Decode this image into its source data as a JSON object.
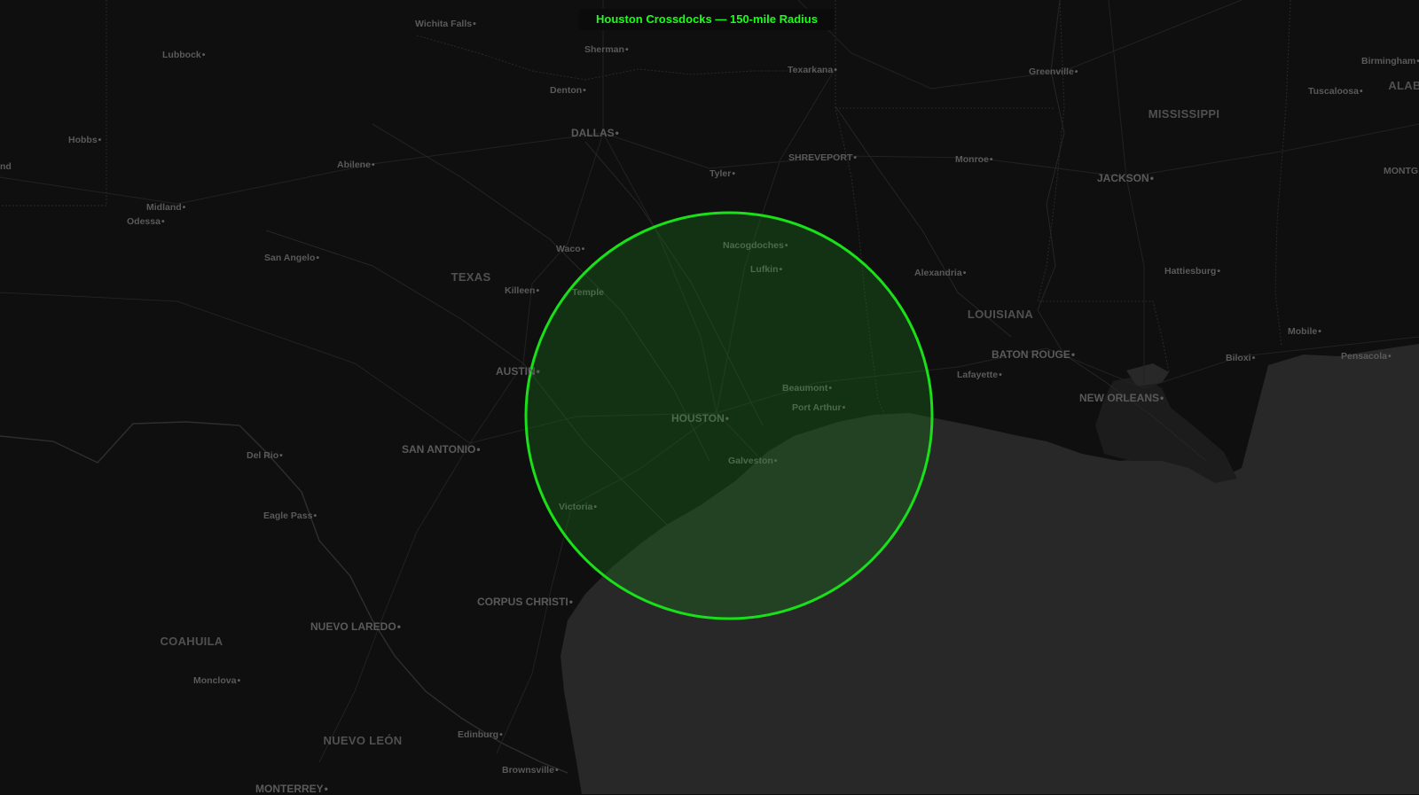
{
  "title": "Houston Crossdocks — 150-mile Radius",
  "colors": {
    "land": "#0f0f0f",
    "water": "#282828",
    "circle_stroke": "#19e019",
    "circle_fill": "#1a7a1a",
    "label": "#5a5a5a",
    "title_text": "#19ff19"
  },
  "radius_circle": {
    "center": "HOUSTON",
    "radius_miles": 150
  },
  "regions": [
    {
      "name": "TEXAS"
    },
    {
      "name": "LOUISIANA"
    },
    {
      "name": "MISSISSIPPI"
    },
    {
      "name": "ALAB"
    },
    {
      "name": "COAHUILA"
    },
    {
      "name": "NUEVO LEÓN"
    }
  ],
  "cities": [
    {
      "name": "Wichita Falls"
    },
    {
      "name": "Lubbock"
    },
    {
      "name": "Sherman"
    },
    {
      "name": "Texarkana"
    },
    {
      "name": "Greenville"
    },
    {
      "name": "Birmingham"
    },
    {
      "name": "Tuscaloosa"
    },
    {
      "name": "Denton"
    },
    {
      "name": "DALLAS"
    },
    {
      "name": "Hobbs"
    },
    {
      "name": "Abilene"
    },
    {
      "name": "SHREVEPORT"
    },
    {
      "name": "Monroe"
    },
    {
      "name": "JACKSON"
    },
    {
      "name": "MONTG"
    },
    {
      "name": "Tyler"
    },
    {
      "name": "Midland"
    },
    {
      "name": "Odessa"
    },
    {
      "name": "Waco"
    },
    {
      "name": "Nacogdoches"
    },
    {
      "name": "San Angelo"
    },
    {
      "name": "Lufkin"
    },
    {
      "name": "Alexandria"
    },
    {
      "name": "Hattiesburg"
    },
    {
      "name": "Killeen"
    },
    {
      "name": "Temple"
    },
    {
      "name": "Mobile"
    },
    {
      "name": "BATON ROUGE"
    },
    {
      "name": "Biloxi"
    },
    {
      "name": "Pensacola"
    },
    {
      "name": "AUSTIN"
    },
    {
      "name": "Lafayette"
    },
    {
      "name": "Beaumont"
    },
    {
      "name": "NEW ORLEANS"
    },
    {
      "name": "Port Arthur"
    },
    {
      "name": "HOUSTON"
    },
    {
      "name": "SAN ANTONIO"
    },
    {
      "name": "Del Rio"
    },
    {
      "name": "Galveston"
    },
    {
      "name": "Victoria"
    },
    {
      "name": "Eagle Pass"
    },
    {
      "name": "CORPUS CHRISTI"
    },
    {
      "name": "NUEVO LAREDO"
    },
    {
      "name": "Monclova"
    },
    {
      "name": "Edinburg"
    },
    {
      "name": "Brownsville"
    },
    {
      "name": "MONTERREY"
    },
    {
      "name": "nd"
    }
  ]
}
